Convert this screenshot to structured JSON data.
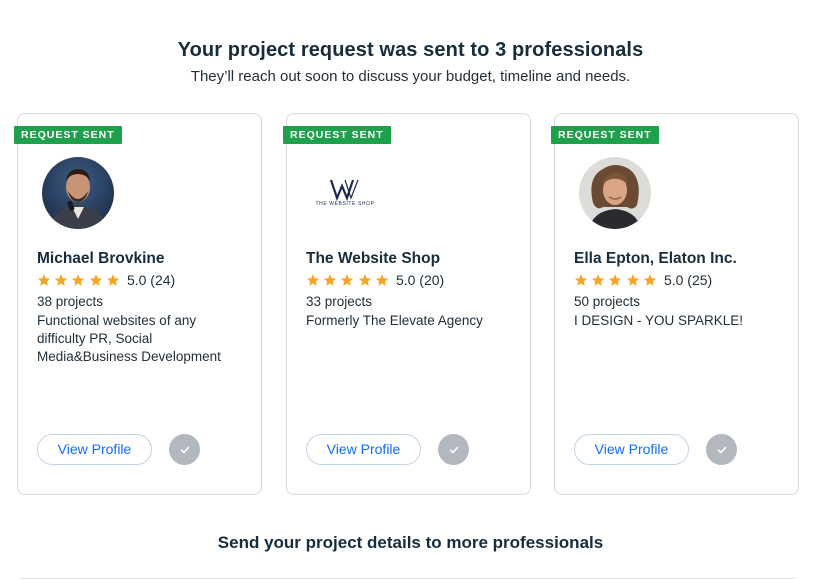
{
  "header": {
    "title": "Your project request was sent to 3 professionals",
    "subtitle": "They’ll reach out soon to discuss your budget, timeline and needs."
  },
  "colors": {
    "badge": "#1ea14c",
    "star": "#f5a623",
    "link": "#116dff",
    "check_bg": "#b3b8be"
  },
  "cards": [
    {
      "badge": "REQUEST SENT",
      "avatar": "person-photo",
      "name": "Michael Brovkine",
      "rating": "5.0 (24)",
      "stars": 5,
      "projects": "38 projects",
      "description": "Functional websites of any difficulty PR, Social Media&Business Development",
      "view_label": "View Profile",
      "check_icon": "checkmark-icon"
    },
    {
      "badge": "REQUEST SENT",
      "avatar": "company-logo",
      "logo_text": "THE WEBSITE SHOP",
      "name": "The Website Shop",
      "rating": "5.0 (20)",
      "stars": 5,
      "projects": "33 projects",
      "description": "Formerly The Elevate Agency",
      "view_label": "View Profile",
      "check_icon": "checkmark-icon"
    },
    {
      "badge": "REQUEST SENT",
      "avatar": "person-photo",
      "name": "Ella Epton, Elaton Inc.",
      "rating": "5.0 (25)",
      "stars": 5,
      "projects": "50 projects",
      "description": "I DESIGN - YOU SPARKLE!",
      "view_label": "View Profile",
      "check_icon": "checkmark-icon"
    }
  ],
  "footer": {
    "title": "Send your project details to more professionals"
  }
}
